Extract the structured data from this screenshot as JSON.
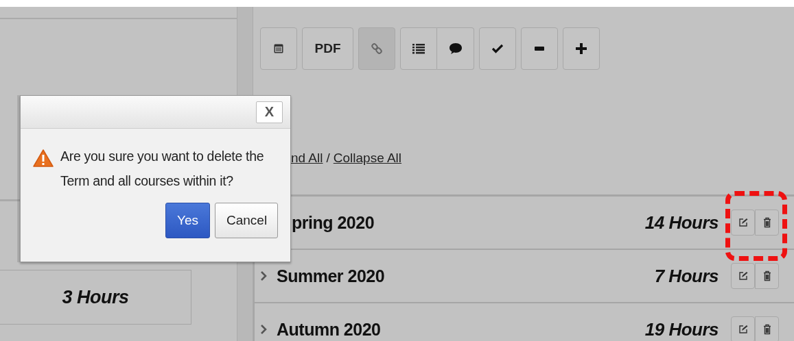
{
  "toolbar": {
    "buttons": [
      {
        "kind": "icon",
        "pressed": false
      },
      {
        "kind": "text",
        "label": "PDF",
        "pressed": false
      },
      {
        "kind": "icon",
        "pressed": true
      },
      {
        "kind": "icon",
        "pressed": false
      },
      {
        "kind": "icon",
        "pressed": false
      },
      {
        "kind": "icon",
        "pressed": false
      },
      {
        "kind": "icon",
        "pressed": false
      },
      {
        "kind": "icon",
        "pressed": false
      }
    ]
  },
  "links": {
    "expand": "nd All",
    "separator": "/",
    "collapse": "Collapse All"
  },
  "left_panel": {
    "hours": "3 Hours"
  },
  "terms": [
    {
      "title": "pring 2020",
      "hours": "14 Hours",
      "chevron": false,
      "highlighted": true
    },
    {
      "title": "Summer 2020",
      "hours": "7 Hours",
      "chevron": true,
      "highlighted": false
    },
    {
      "title": "Autumn 2020",
      "hours": "19 Hours",
      "chevron": true,
      "highlighted": false
    }
  ],
  "dialog": {
    "close_label": "X",
    "message": "Are you sure you want to delete the Term and all courses within it?",
    "buttons": [
      {
        "label": "Yes",
        "primary": true
      },
      {
        "label": "Cancel",
        "primary": false
      }
    ]
  }
}
